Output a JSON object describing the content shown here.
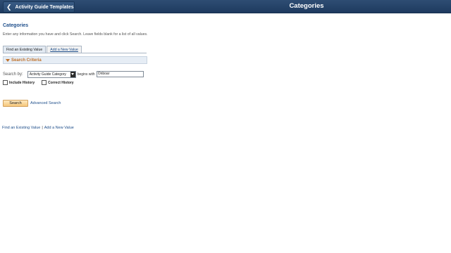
{
  "header": {
    "back_label": "Activity Guide Templates",
    "title": "Categories"
  },
  "page": {
    "title": "Categories",
    "instructions": "Enter any information you have and click Search. Leave fields blank for a list of all values."
  },
  "tabs": [
    {
      "label": "Find an Existing Value",
      "active": true
    },
    {
      "label": "Add a New Value",
      "active": false
    }
  ],
  "criteria": {
    "section_label": "Search Criteria",
    "search_by_label": "Search by:",
    "search_by_selected": "Activity Guide Category",
    "operator_text": "begins with",
    "input_value": "Onboar"
  },
  "checkboxes": [
    {
      "label": "Include History",
      "checked": false
    },
    {
      "label": "Correct History",
      "checked": false
    }
  ],
  "actions": {
    "search_label": "Search",
    "advanced_label": "Advanced Search"
  },
  "footer": {
    "find_label": "Find an Existing Value",
    "separator": "|",
    "add_label": "Add a New Value"
  }
}
